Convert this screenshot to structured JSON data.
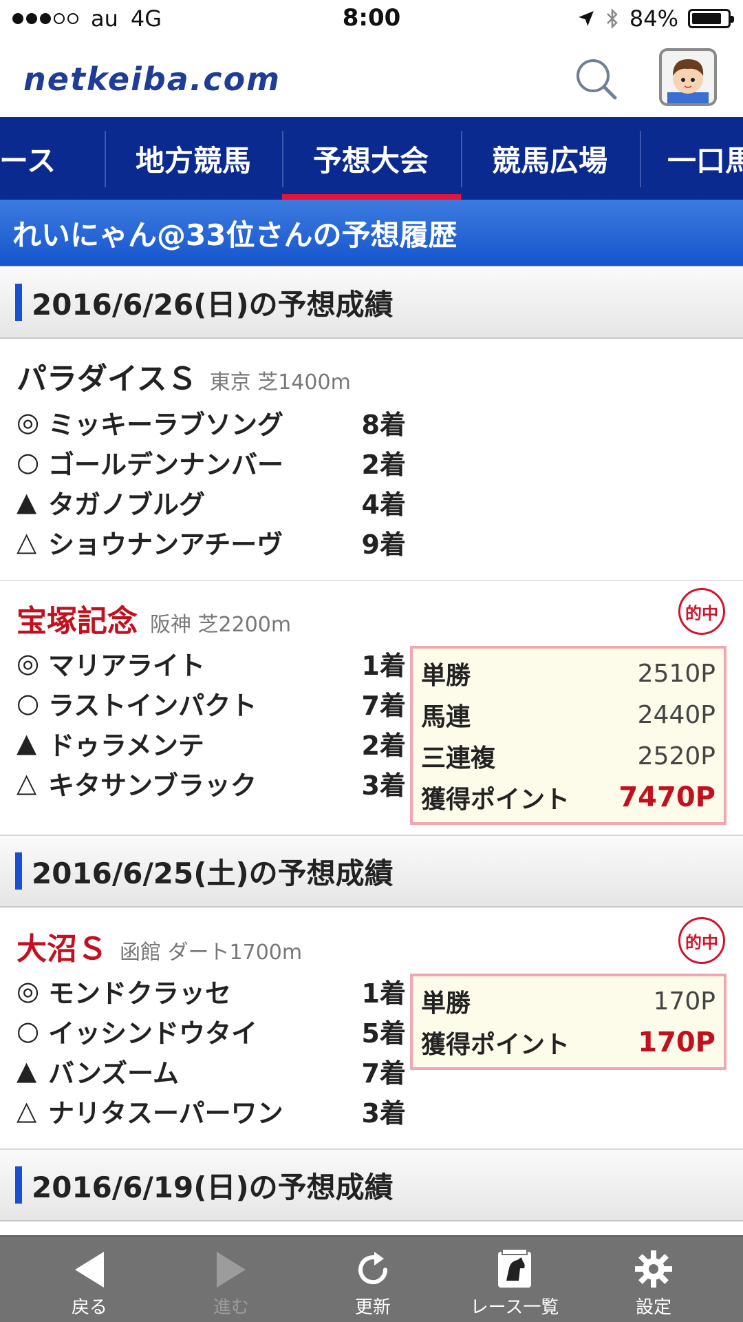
{
  "status": {
    "carrier": "au",
    "network": "4G",
    "time": "8:00",
    "battery": "84%"
  },
  "header": {
    "logo": "netkeiba.com"
  },
  "nav": {
    "items": [
      "ベース",
      "地方競馬",
      "予想大会",
      "競馬広場",
      "一口馬"
    ],
    "active_index": 2
  },
  "page_title": "れいにゃん@33位さんの予想履歴",
  "sections": [
    {
      "date": "2016/6/26(日)の予想成績",
      "races": [
        {
          "name": "パラダイスＳ",
          "info": "東京 芝1400m",
          "hit": false,
          "picks": [
            {
              "mark": "◎",
              "horse": "ミッキーラブソング",
              "place": "8着"
            },
            {
              "mark": "○",
              "horse": "ゴールデンナンバー",
              "place": "2着"
            },
            {
              "mark": "▲",
              "horse": "タガノブルグ",
              "place": "4着"
            },
            {
              "mark": "△",
              "horse": "ショウナンアチーヴ",
              "place": "9着"
            }
          ]
        },
        {
          "name": "宝塚記念",
          "info": "阪神 芝2200m",
          "hit": true,
          "hit_label": "的中",
          "picks": [
            {
              "mark": "◎",
              "horse": "マリアライト",
              "place": "1着"
            },
            {
              "mark": "○",
              "horse": "ラストインパクト",
              "place": "7着"
            },
            {
              "mark": "▲",
              "horse": "ドゥラメンテ",
              "place": "2着"
            },
            {
              "mark": "△",
              "horse": "キタサンブラック",
              "place": "3着"
            }
          ],
          "payouts": [
            {
              "label": "単勝",
              "value": "2510P"
            },
            {
              "label": "馬連",
              "value": "2440P"
            },
            {
              "label": "三連複",
              "value": "2520P"
            }
          ],
          "total": {
            "label": "獲得ポイント",
            "value": "7470P"
          }
        }
      ]
    },
    {
      "date": "2016/6/25(土)の予想成績",
      "races": [
        {
          "name": "大沼Ｓ",
          "info": "函館 ダート1700m",
          "hit": true,
          "hit_label": "的中",
          "picks": [
            {
              "mark": "◎",
              "horse": "モンドクラッセ",
              "place": "1着"
            },
            {
              "mark": "○",
              "horse": "イッシンドウタイ",
              "place": "5着"
            },
            {
              "mark": "▲",
              "horse": "バンズーム",
              "place": "7着"
            },
            {
              "mark": "△",
              "horse": "ナリタスーパーワン",
              "place": "3着"
            }
          ],
          "payouts": [
            {
              "label": "単勝",
              "value": "170P"
            }
          ],
          "total": {
            "label": "獲得ポイント",
            "value": "170P"
          }
        }
      ]
    },
    {
      "date": "2016/6/19(日)の予想成績",
      "races": []
    }
  ],
  "toolbar": {
    "back": "戻る",
    "forward": "進む",
    "reload": "更新",
    "race_list": "レース一覧",
    "settings": "設定"
  },
  "colors": {
    "nav_bg": "#0b2a8f",
    "accent_red": "#c2101e",
    "title_blue": "#1555cc"
  }
}
